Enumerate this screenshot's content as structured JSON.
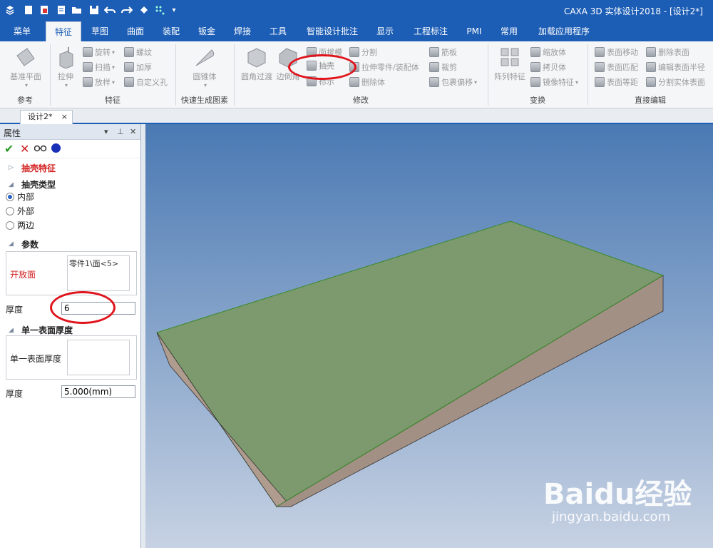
{
  "app": {
    "title": "CAXA 3D 实体设计2018 - [设计2*]"
  },
  "menu_tabs": [
    "菜单",
    "特征",
    "草图",
    "曲面",
    "装配",
    "钣金",
    "焊接",
    "工具",
    "智能设计批注",
    "显示",
    "工程标注",
    "PMI",
    "常用",
    "加载应用程序"
  ],
  "active_tab": "特征",
  "ribbon": {
    "groups": {
      "reference": "参考",
      "feature": "特征",
      "quick": "快速生成图素",
      "modify": "修改",
      "transform": "变换",
      "direct_edit": "直接编辑"
    },
    "buttons": {
      "datum_plane": "基准平面",
      "extrude": "拉伸",
      "revolve": "旋转",
      "sweep": "扫描",
      "loft": "放样",
      "thread": "螺纹",
      "thicken": "加厚",
      "custom_hole": "自定义孔",
      "cone": "圆锥体",
      "fillet": "圆角过渡",
      "chamfer": "边倒角",
      "draft": "面拔模",
      "shell": "抽壳",
      "mark": "标示",
      "split": "分割",
      "stretch_part": "拉伸零件/装配体",
      "delete_body": "删除体",
      "rib": "筋板",
      "trim": "裁剪",
      "wrap_offset": "包裹偏移",
      "pattern": "阵列特征",
      "scale": "缩放体",
      "copy_body": "拷贝体",
      "mirror": "镜像特征",
      "face_move": "表面移动",
      "face_match": "表面匹配",
      "face_distance": "表面等距",
      "delete_face": "删除表面",
      "edit_radius": "编辑表面半径",
      "split_solid_face": "分割实体表面"
    }
  },
  "document_tab": "设计2*",
  "panel": {
    "title": "属性",
    "feature_name": "抽壳特征",
    "shell_type_title": "抽壳类型",
    "shell_type_options": [
      "内部",
      "外部",
      "两边"
    ],
    "shell_type_selected": "内部",
    "params_title": "参数",
    "open_face_label": "开放面",
    "open_face_value": "零件1\\面<5>",
    "thickness_label": "厚度",
    "thickness_value": "6",
    "single_title": "单一表面厚度",
    "single_label": "单一表面厚度",
    "single_thickness_label": "厚度",
    "single_thickness_value": "5.000(mm)"
  },
  "colors": {
    "accent": "#1c5db5",
    "slab_top": "#7c9a6e",
    "slab_side": "#a39085",
    "highlight": "#e0141c"
  },
  "watermark": {
    "brand": "Baidu经验",
    "url": "jingyan.baidu.com"
  }
}
